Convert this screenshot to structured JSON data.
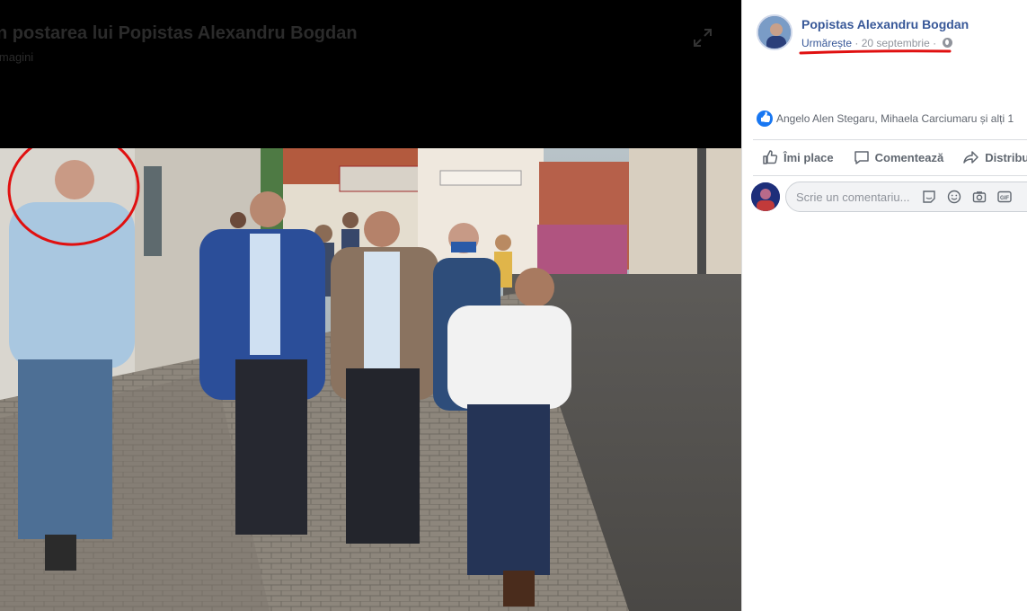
{
  "viewer": {
    "title": "n postarea lui Popistas Alexandru Bogdan",
    "subtitle": "lmagini"
  },
  "post": {
    "author": "Popistas Alexandru Bogdan",
    "follow_label": "Urmărește",
    "separator": "·",
    "date": "20 septembrie",
    "reactions_text": "Angelo Alen Stegaru, Mihaela Carciumaru și alți 1",
    "actions": {
      "like": "Îmi place",
      "comment": "Comentează",
      "share": "Distribuie"
    },
    "comment_placeholder": "Scrie un comentariu..."
  },
  "colors": {
    "link": "#385898",
    "annotation_red": "#e01010",
    "like_blue": "#1877f2"
  },
  "icons": [
    "expand-icon",
    "globe-icon",
    "like-icon",
    "comment-icon",
    "share-icon",
    "sticker-icon",
    "emoji-icon",
    "camera-icon",
    "gif-icon"
  ]
}
